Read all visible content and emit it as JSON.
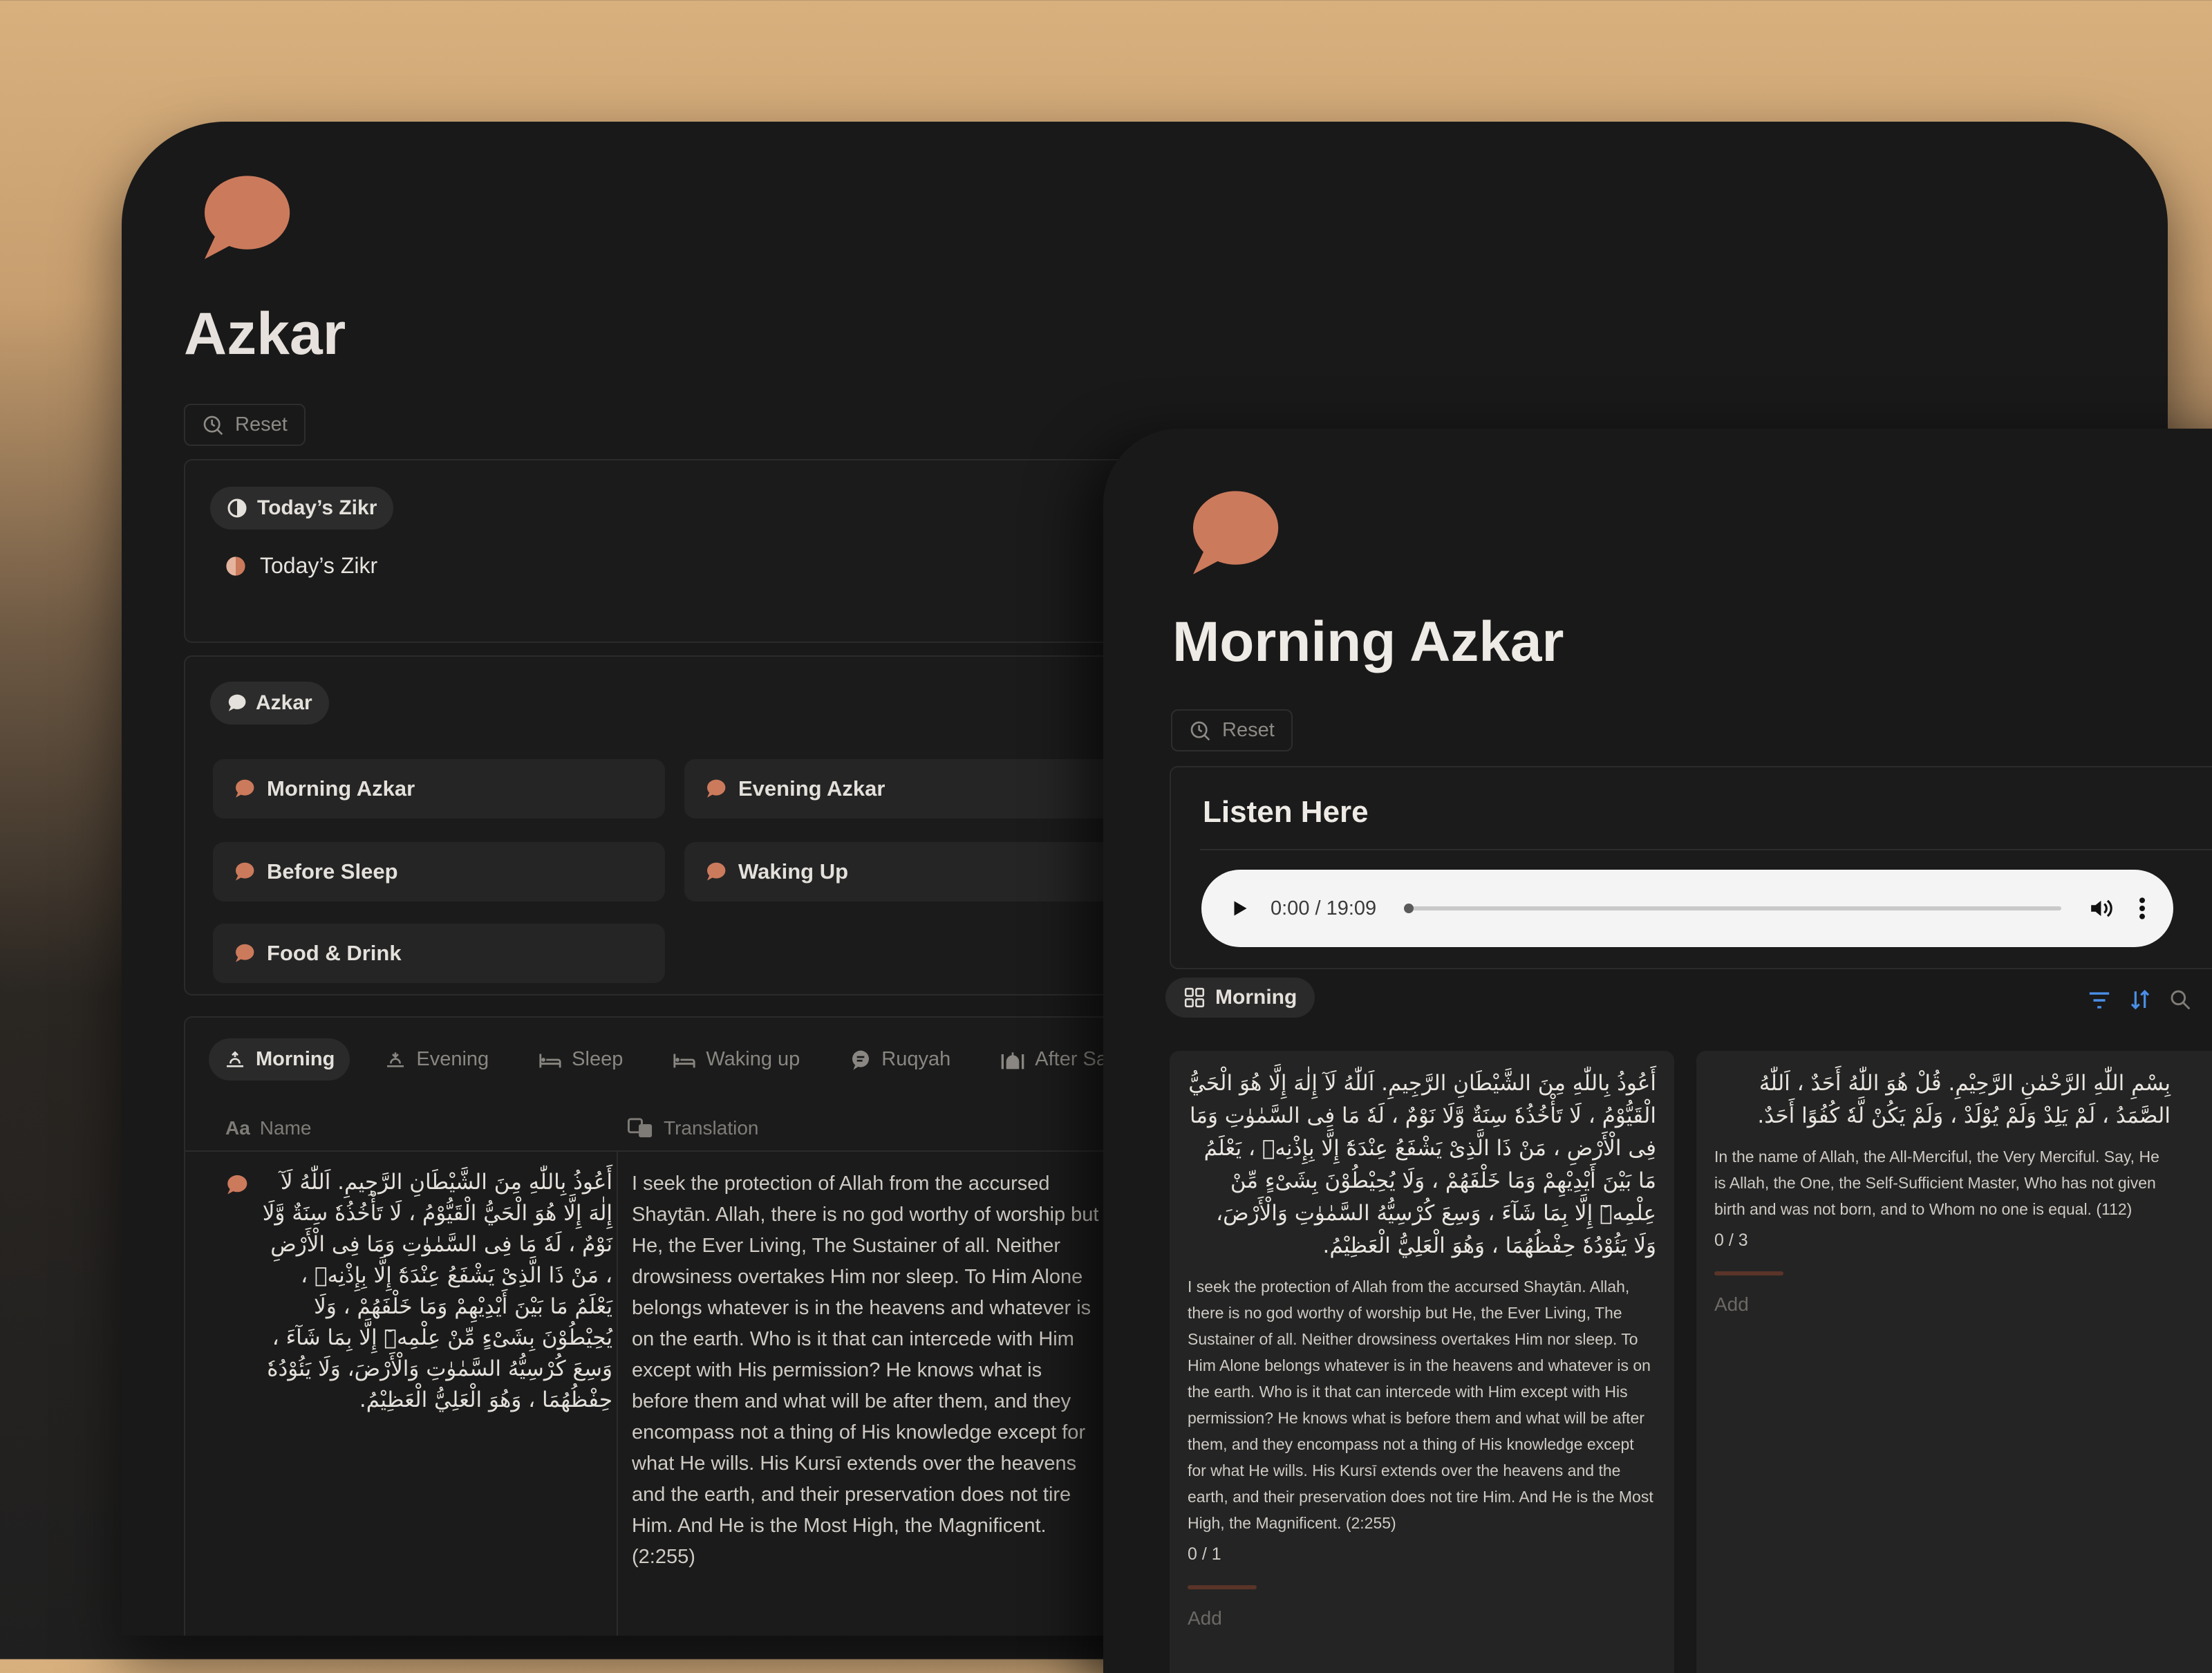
{
  "colors": {
    "accent": "#cc7a5c",
    "background": "#191919",
    "card": "#242424",
    "link_blue": "#4a8fe7"
  },
  "back_page": {
    "title": "Azkar",
    "reset_label": "Reset",
    "todays_section": {
      "chip_label": "Today’s Zikr",
      "link_label": "Today’s Zikr"
    },
    "azkar_section": {
      "chip_label": "Azkar",
      "tiles": [
        "Morning Azkar",
        "Evening Azkar",
        "Before Sleep",
        "Waking Up",
        "Food & Drink"
      ]
    },
    "tabs": [
      "Morning",
      "Evening",
      "Sleep",
      "Waking up",
      "Ruqyah",
      "After Salah"
    ],
    "active_tab": "Morning",
    "columns": {
      "name": "Name",
      "translation": "Translation"
    },
    "rows": [
      {
        "name": "أَعُوذُ بِاللّٰهِ مِنَ الشَّيْطَانِ الرَّجِيمِ. اَللّٰهُ لَآ إِلٰهَ إِلَّا هُوَ الْحَيُّ الْقَيُّوْمُ ، لَا تَأْخُذُهٗ سِنَةٌ وَّلَا نَوْمٌ ، لَهٗ مَا فِى السَّمٰوٰتِ وَمَا فِى الْأَرْضِ ، مَنْ ذَا الَّذِىْ يَشْفَعُ عِنْدَهٗٓ إِلَّا بِإِذْنِهٖ ، يَعْلَمُ مَا بَيْنَ أَيْدِيْهِمْ وَمَا خَلْفَهُمْ ، وَلَا يُحِيْطُوْنَ بِشَىْءٍ مِّنْ عِلْمِهٖٓ إِلَّا بِمَا شَآءَ ، وَسِعَ كُرْسِيُّهُ السَّمٰوٰتِ وَالْأَرْضَ، وَلَا يَئُوْدُهٗ حِفْظُهُمَا ، وَهُوَ الْعَلِيُّ الْعَظِيْمُ.",
        "translation": "I seek the protection of Allah from the accursed Shaytān. Allah, there is no god worthy of worship but He, the Ever Living, The Sustainer of all. Neither drowsiness overtakes Him nor sleep. To Him Alone belongs whatever is in the heavens and whatever is on the earth. Who is it that can intercede with Him except with His permission? He knows what is before them and what will be after them, and they encompass not a thing of His knowledge except for what He wills. His Kursī extends over the heavens and the earth, and their preservation does not tire Him. And He is the Most High, the Magnificent. (2:255)"
      }
    ]
  },
  "front_page": {
    "title": "Morning Azkar",
    "reset_label": "Reset",
    "listen": {
      "title": "Listen Here",
      "time": "0:00 / 19:09",
      "progress": 0.0
    },
    "view_chip": "Morning",
    "cards": [
      {
        "arabic": "أَعُوذُ بِاللّٰهِ مِنَ الشَّيْطَانِ الرَّجِيمِ. اَللّٰهُ لَآ إِلٰهَ إِلَّا هُوَ الْحَيُّ الْقَيُّوْمُ ، لَا تَأْخُذُهٗ سِنَةٌ وَّلَا نَوْمٌ ، لَهٗ مَا فِى السَّمٰوٰتِ وَمَا فِى الْأَرْضِ ، مَنْ ذَا الَّذِىْ يَشْفَعُ عِنْدَهٗٓ إِلَّا بِإِذْنِهٖ ، يَعْلَمُ مَا بَيْنَ أَيْدِيْهِمْ وَمَا خَلْفَهُمْ ، وَلَا يُحِيْطُوْنَ بِشَىْءٍ مِّنْ عِلْمِهٖٓ إِلَّا بِمَا شَآءَ ، وَسِعَ كُرْسِيُّهُ السَّمٰوٰتِ وَالْأَرْضَ، وَلَا يَئُوْدُهٗ حِفْظُهُمَا ، وَهُوَ الْعَلِيُّ الْعَظِيْمُ.",
        "translation": "I seek the protection of Allah from the accursed Shaytān. Allah, there is no god worthy of worship but He, the Ever Living, The Sustainer of all. Neither drowsiness overtakes Him nor sleep. To Him Alone belongs whatever is in the heavens and whatever is on the earth. Who is it that can intercede with Him except with His permission? He knows what is before them and what will be after them, and they encompass not a thing of His knowledge except for what He wills. His Kursī extends over the heavens and the earth, and their preservation does not tire Him. And He is the Most High, the Magnificent. (2:255)",
        "count": "0 / 1",
        "add_label": "Add"
      },
      {
        "arabic": "بِسْمِ اللّٰهِ الرَّحْمٰنِ الرَّحِيْمِ. قُلْ هُوَ اللّٰهُ أَحَدٌ ، اَللّٰهُ الصَّمَدُ ، لَمْ يَلِدْ وَلَمْ يُوْلَدْ ، وَلَمْ يَكُنْ لَّهٗ كُفُوًا أَحَدٌ.",
        "translation": "In the name of Allah, the All-Merciful, the Very Merciful. Say, He is Allah, the One, the Self-Sufficient Master, Who has not given birth and was not born, and to Whom no one is equal. (112)",
        "count": "0 / 3",
        "add_label": "Add"
      }
    ]
  }
}
